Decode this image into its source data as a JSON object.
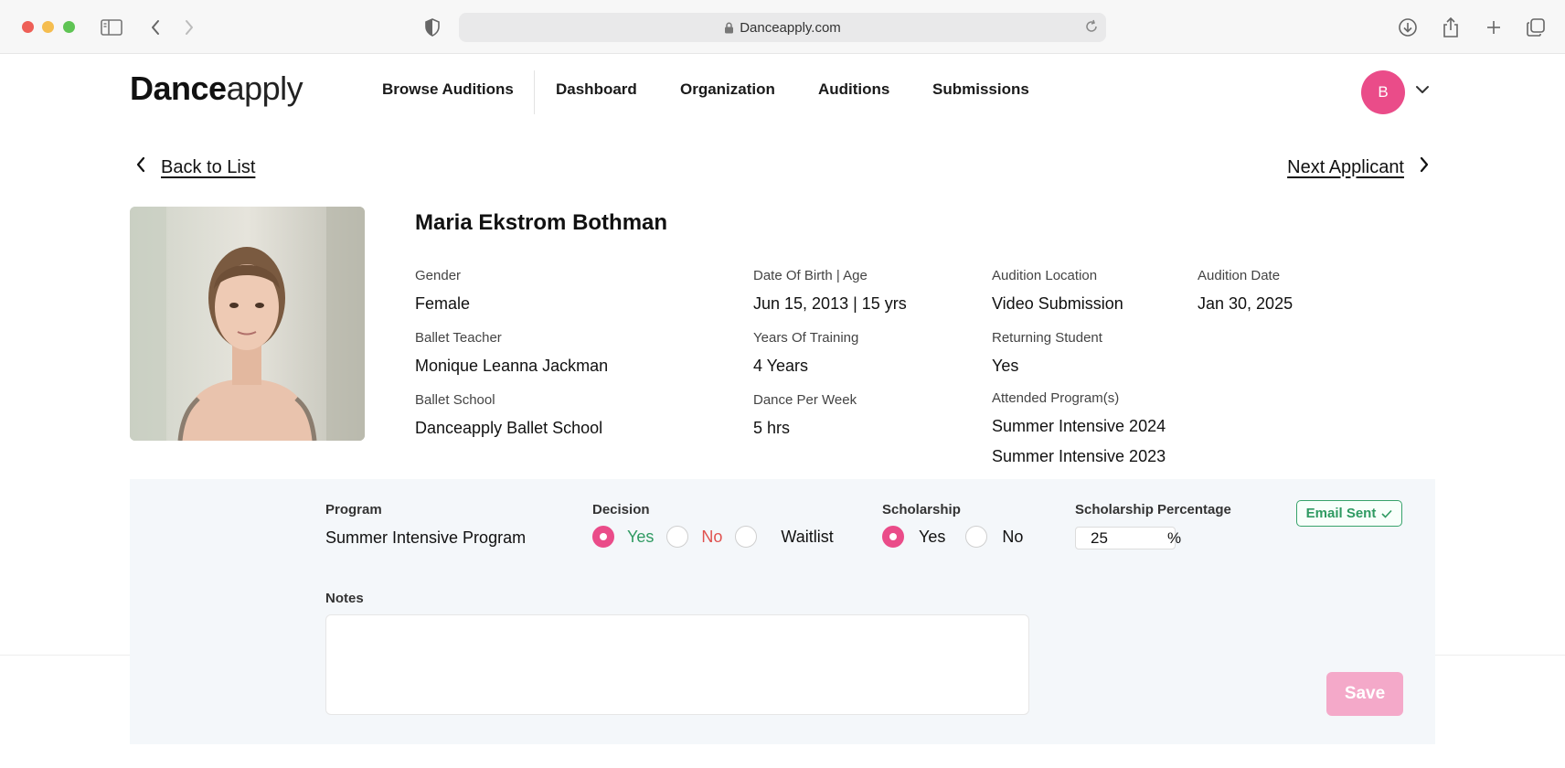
{
  "browser": {
    "url": "Danceapply.com"
  },
  "header": {
    "logo_bold": "Dance",
    "logo_light": "apply",
    "nav": [
      "Browse Auditions",
      "Dashboard",
      "Organization",
      "Auditions",
      "Submissions"
    ],
    "avatar_initial": "B"
  },
  "navigation": {
    "back_label": "Back to List",
    "next_label": "Next Applicant"
  },
  "applicant": {
    "name": "Maria Ekstrom Bothman",
    "fields": {
      "gender": {
        "label": "Gender",
        "value": "Female"
      },
      "dob": {
        "label": "Date Of Birth | Age",
        "value": "Jun 15, 2013 | 15 yrs"
      },
      "location": {
        "label": "Audition Location",
        "value": "Video Submission"
      },
      "date": {
        "label": "Audition Date",
        "value": "Jan 30, 2025"
      },
      "teacher": {
        "label": "Ballet Teacher",
        "value": "Monique Leanna Jackman"
      },
      "training": {
        "label": "Years Of Training",
        "value": "4 Years"
      },
      "returning": {
        "label": "Returning Student",
        "value": "Yes"
      },
      "school": {
        "label": "Ballet School",
        "value": "Danceapply Ballet School"
      },
      "per_week": {
        "label": "Dance Per Week",
        "value": "5 hrs"
      },
      "programs": {
        "label": "Attended Program(s)",
        "values": [
          "Summer Intensive 2024",
          "Summer Intensive 2023"
        ]
      }
    }
  },
  "decision_panel": {
    "program": {
      "label": "Program",
      "value": "Summer Intensive Program"
    },
    "decision": {
      "label": "Decision",
      "options": [
        "Yes",
        "No",
        "Waitlist"
      ],
      "selected": "Yes",
      "colors": {
        "yes": "#2f9a62",
        "no": "#e0524f",
        "waitlist": "#111111"
      }
    },
    "scholarship": {
      "label": "Scholarship",
      "options": [
        "Yes",
        "No"
      ],
      "selected": "Yes"
    },
    "scholarship_percentage": {
      "label": "Scholarship Percentage",
      "value": "25",
      "unit": "%"
    },
    "email_status": "Email Sent",
    "notes_label": "Notes",
    "notes_value": "",
    "save_label": "Save"
  },
  "colors": {
    "accent": "#ea4c89",
    "save_disabled": "#f4a9c9",
    "success": "#2f9a62"
  }
}
